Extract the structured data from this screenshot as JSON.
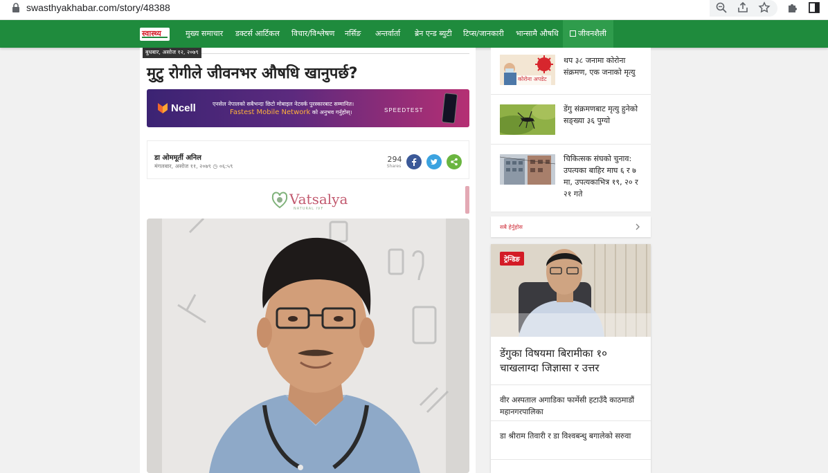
{
  "browser": {
    "url": "swasthyakhabar.com/story/48388"
  },
  "nav": {
    "logo": "स्वास्थ्य",
    "items": [
      {
        "label": "मुख्य समाचार"
      },
      {
        "label": "डक्टर्स आर्टिकल"
      },
      {
        "label": "विचार/विश्लेषण"
      },
      {
        "label": "नर्सिङ"
      },
      {
        "label": "अन्तर्वार्ता"
      },
      {
        "label": "ब्रेन एन्ड ब्युटी"
      },
      {
        "label": "टिप्स/जानकारी"
      },
      {
        "label": "भान्सामै औषधि"
      },
      {
        "label": "जीवनशैली"
      }
    ]
  },
  "article": {
    "date_tag": "बुधबार, असोज १२, २०७९",
    "headline": "मुटु रोगीले जीवनभर औषधि खानुपर्छ?",
    "author": "डा ओममूर्ती अनिल",
    "published": "मंगलबार, असोज ११, २०७९ ◷ ०६:५९",
    "share_count": "294",
    "share_label": "Shares"
  },
  "ads": {
    "ncell_brand": "Ncell",
    "ncell_line1": "एनसेल नेपालको सबैभन्दा छिटो मोबाइल नेटवर्क पुरस्कारबाट सम्मानित।",
    "ncell_line2": "Fastest Mobile Network",
    "ncell_line2_suffix": " को अनुभव गर्नुहोस्।",
    "ncell_speedtest": "SPEEDTEST",
    "vatsalya_name": "Vatsalya",
    "vatsalya_sub": "NATURAL IVF"
  },
  "sidebar": {
    "news": [
      {
        "title": "थप ३८ जनामा कोरोना संक्रमण, एक जनाको मृत्यु",
        "thumb_text": "कोरोना अपडेट"
      },
      {
        "title": "डेंगु संक्रमणबाट मृत्यु हुनेको सङ्ख्या ३६ पुग्यो"
      },
      {
        "title": "चिकित्सक संघको चुनाव: उपत्यका बाहिर माघ ६ र ७ मा, उपत्यकाभित्र १९, २० र २१ गते"
      }
    ],
    "more_label": "सबै हेर्नुहोस"
  },
  "trending": {
    "badge": "ट्रेन्डिङ",
    "title": "डेंगुका विषयमा बिरामीका १० चाखलाग्दा जिज्ञासा र उत्तर",
    "items": [
      {
        "title": "वीर अस्पताल अगाडिका फार्मेसी हटाउँदै काठमाडौं महानगरपालिका"
      },
      {
        "title": "डा श्रीराम तिवारी र डा विश्वबन्धु बगालेको सरुवा"
      }
    ]
  }
}
